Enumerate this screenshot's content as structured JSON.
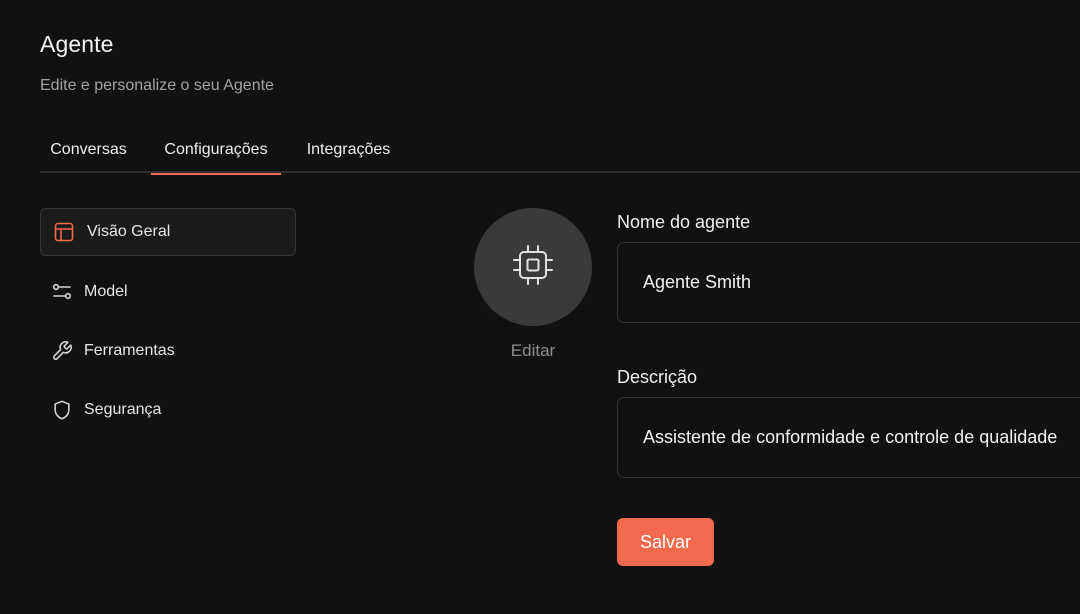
{
  "header": {
    "title": "Agente",
    "subtitle": "Edite e personalize o seu Agente"
  },
  "tabs": [
    {
      "label": "Conversas",
      "active": false
    },
    {
      "label": "Configurações",
      "active": true
    },
    {
      "label": "Integrações",
      "active": false
    }
  ],
  "sidebar": {
    "items": [
      {
        "label": "Visão Geral",
        "icon": "layout-icon",
        "active": true
      },
      {
        "label": "Model",
        "icon": "sliders-icon",
        "active": false
      },
      {
        "label": "Ferramentas",
        "icon": "wrench-icon",
        "active": false
      },
      {
        "label": "Segurança",
        "icon": "shield-icon",
        "active": false
      }
    ]
  },
  "avatar": {
    "icon": "cpu-chip-icon",
    "edit_label": "Editar"
  },
  "form": {
    "name_label": "Nome do agente",
    "name_value": "Agente Smith",
    "description_label": "Descrição",
    "description_value": "Assistente de conformidade e controle de qualidade",
    "save_label": "Salvar"
  },
  "colors": {
    "accent": "#f2694d",
    "background": "#121112",
    "avatar_bg": "#3b3a3b",
    "border": "#363536"
  }
}
